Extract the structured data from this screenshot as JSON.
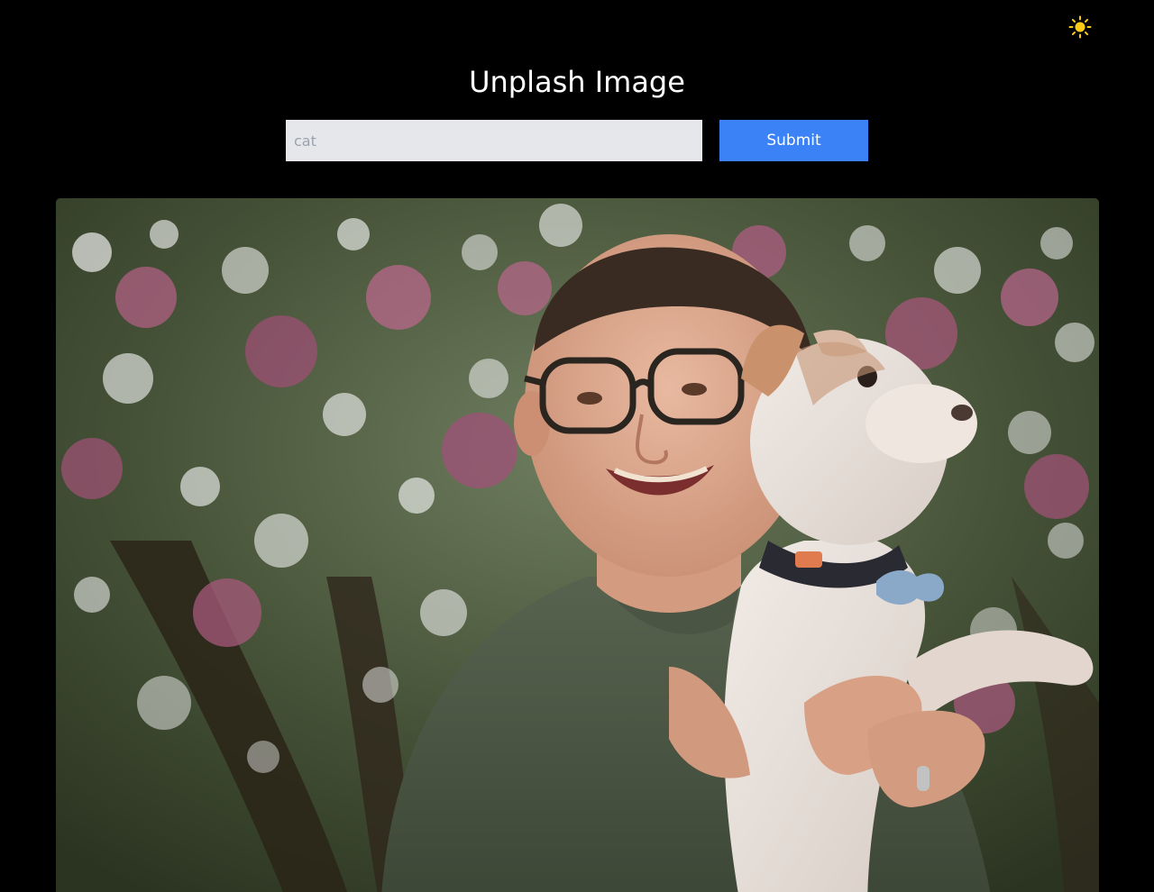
{
  "header": {
    "theme_toggle_icon": "sun-icon",
    "theme_toggle_color": "#facc15"
  },
  "main": {
    "title": "Unplash Image",
    "search": {
      "value": "",
      "placeholder": "cat"
    },
    "submit_label": "Submit",
    "accent_color": "#3b82f6",
    "result_image": {
      "icon": "photo-man-holding-dog"
    }
  }
}
